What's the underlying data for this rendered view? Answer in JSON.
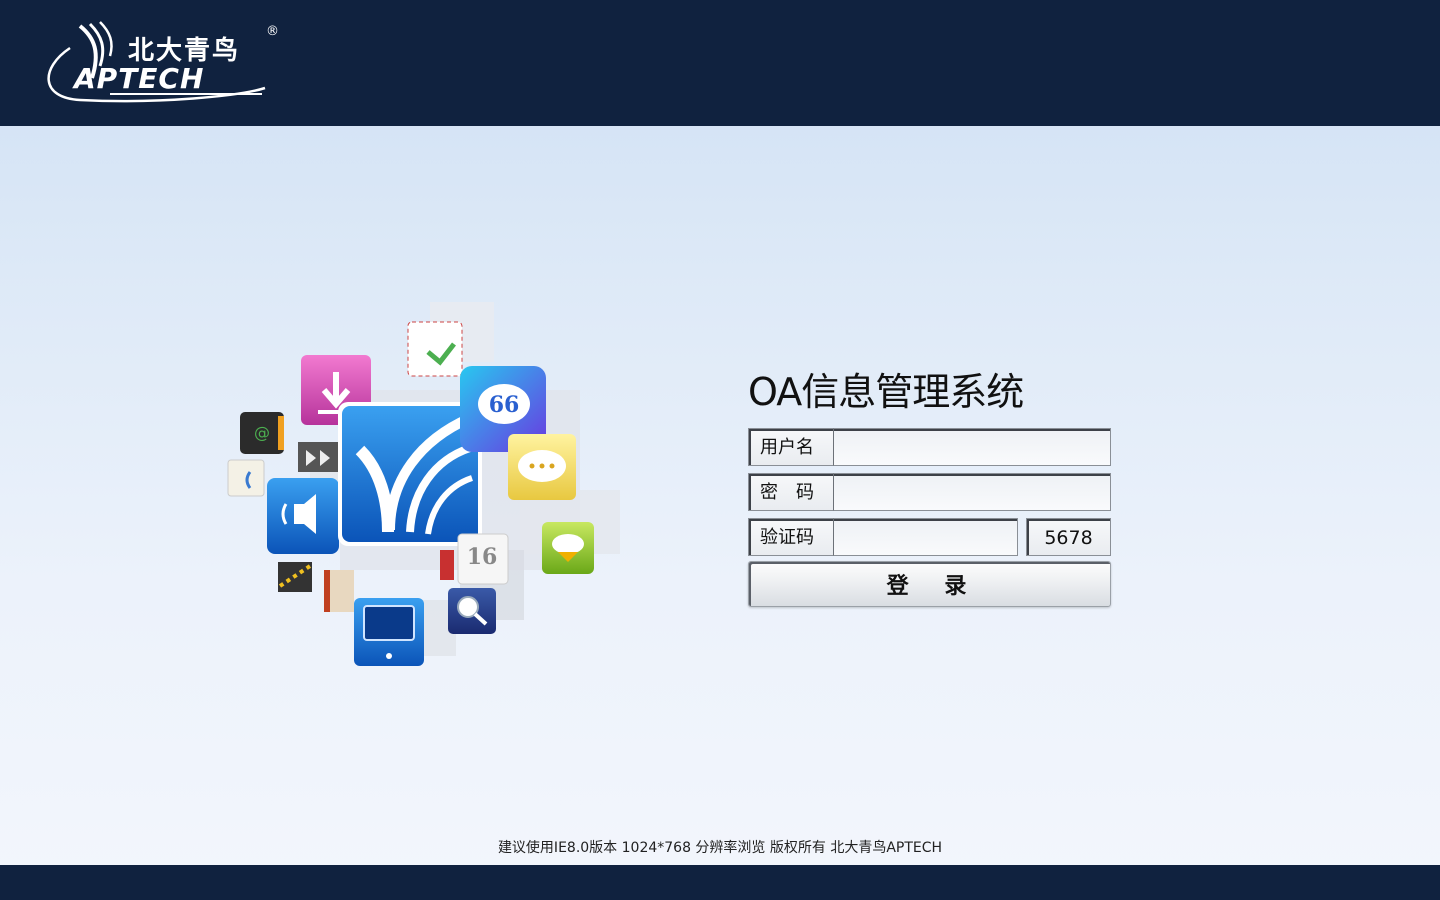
{
  "brand": {
    "name_cn": "北大青鸟",
    "name_en": "APTECH",
    "registered": "®"
  },
  "app": {
    "title": "OA信息管理系统"
  },
  "form": {
    "username_label": "用户名",
    "password_label": "密　码",
    "captcha_label": "验证码",
    "captcha_code": "5678",
    "username_value": "",
    "password_value": "",
    "captcha_value": "",
    "login_label": "登 录"
  },
  "footer": {
    "notice": "建议使用IE8.0版本 1024*768 分辨率浏览 版权所有 北大青鸟APTECH"
  },
  "colors": {
    "header_bg": "#10223f",
    "page_bg_top": "#cfe0f4",
    "page_bg_bottom": "#f3f6fc"
  },
  "hero_icons": [
    "email-icon",
    "download-icon",
    "contacts-icon",
    "media-icon",
    "speaker-icon",
    "brand-app-icon",
    "chat-quote-icon",
    "chat-bubble-icon",
    "cloud-icon",
    "calendar-icon",
    "search-icon",
    "monitor-icon",
    "weather-icon",
    "book-icon"
  ]
}
